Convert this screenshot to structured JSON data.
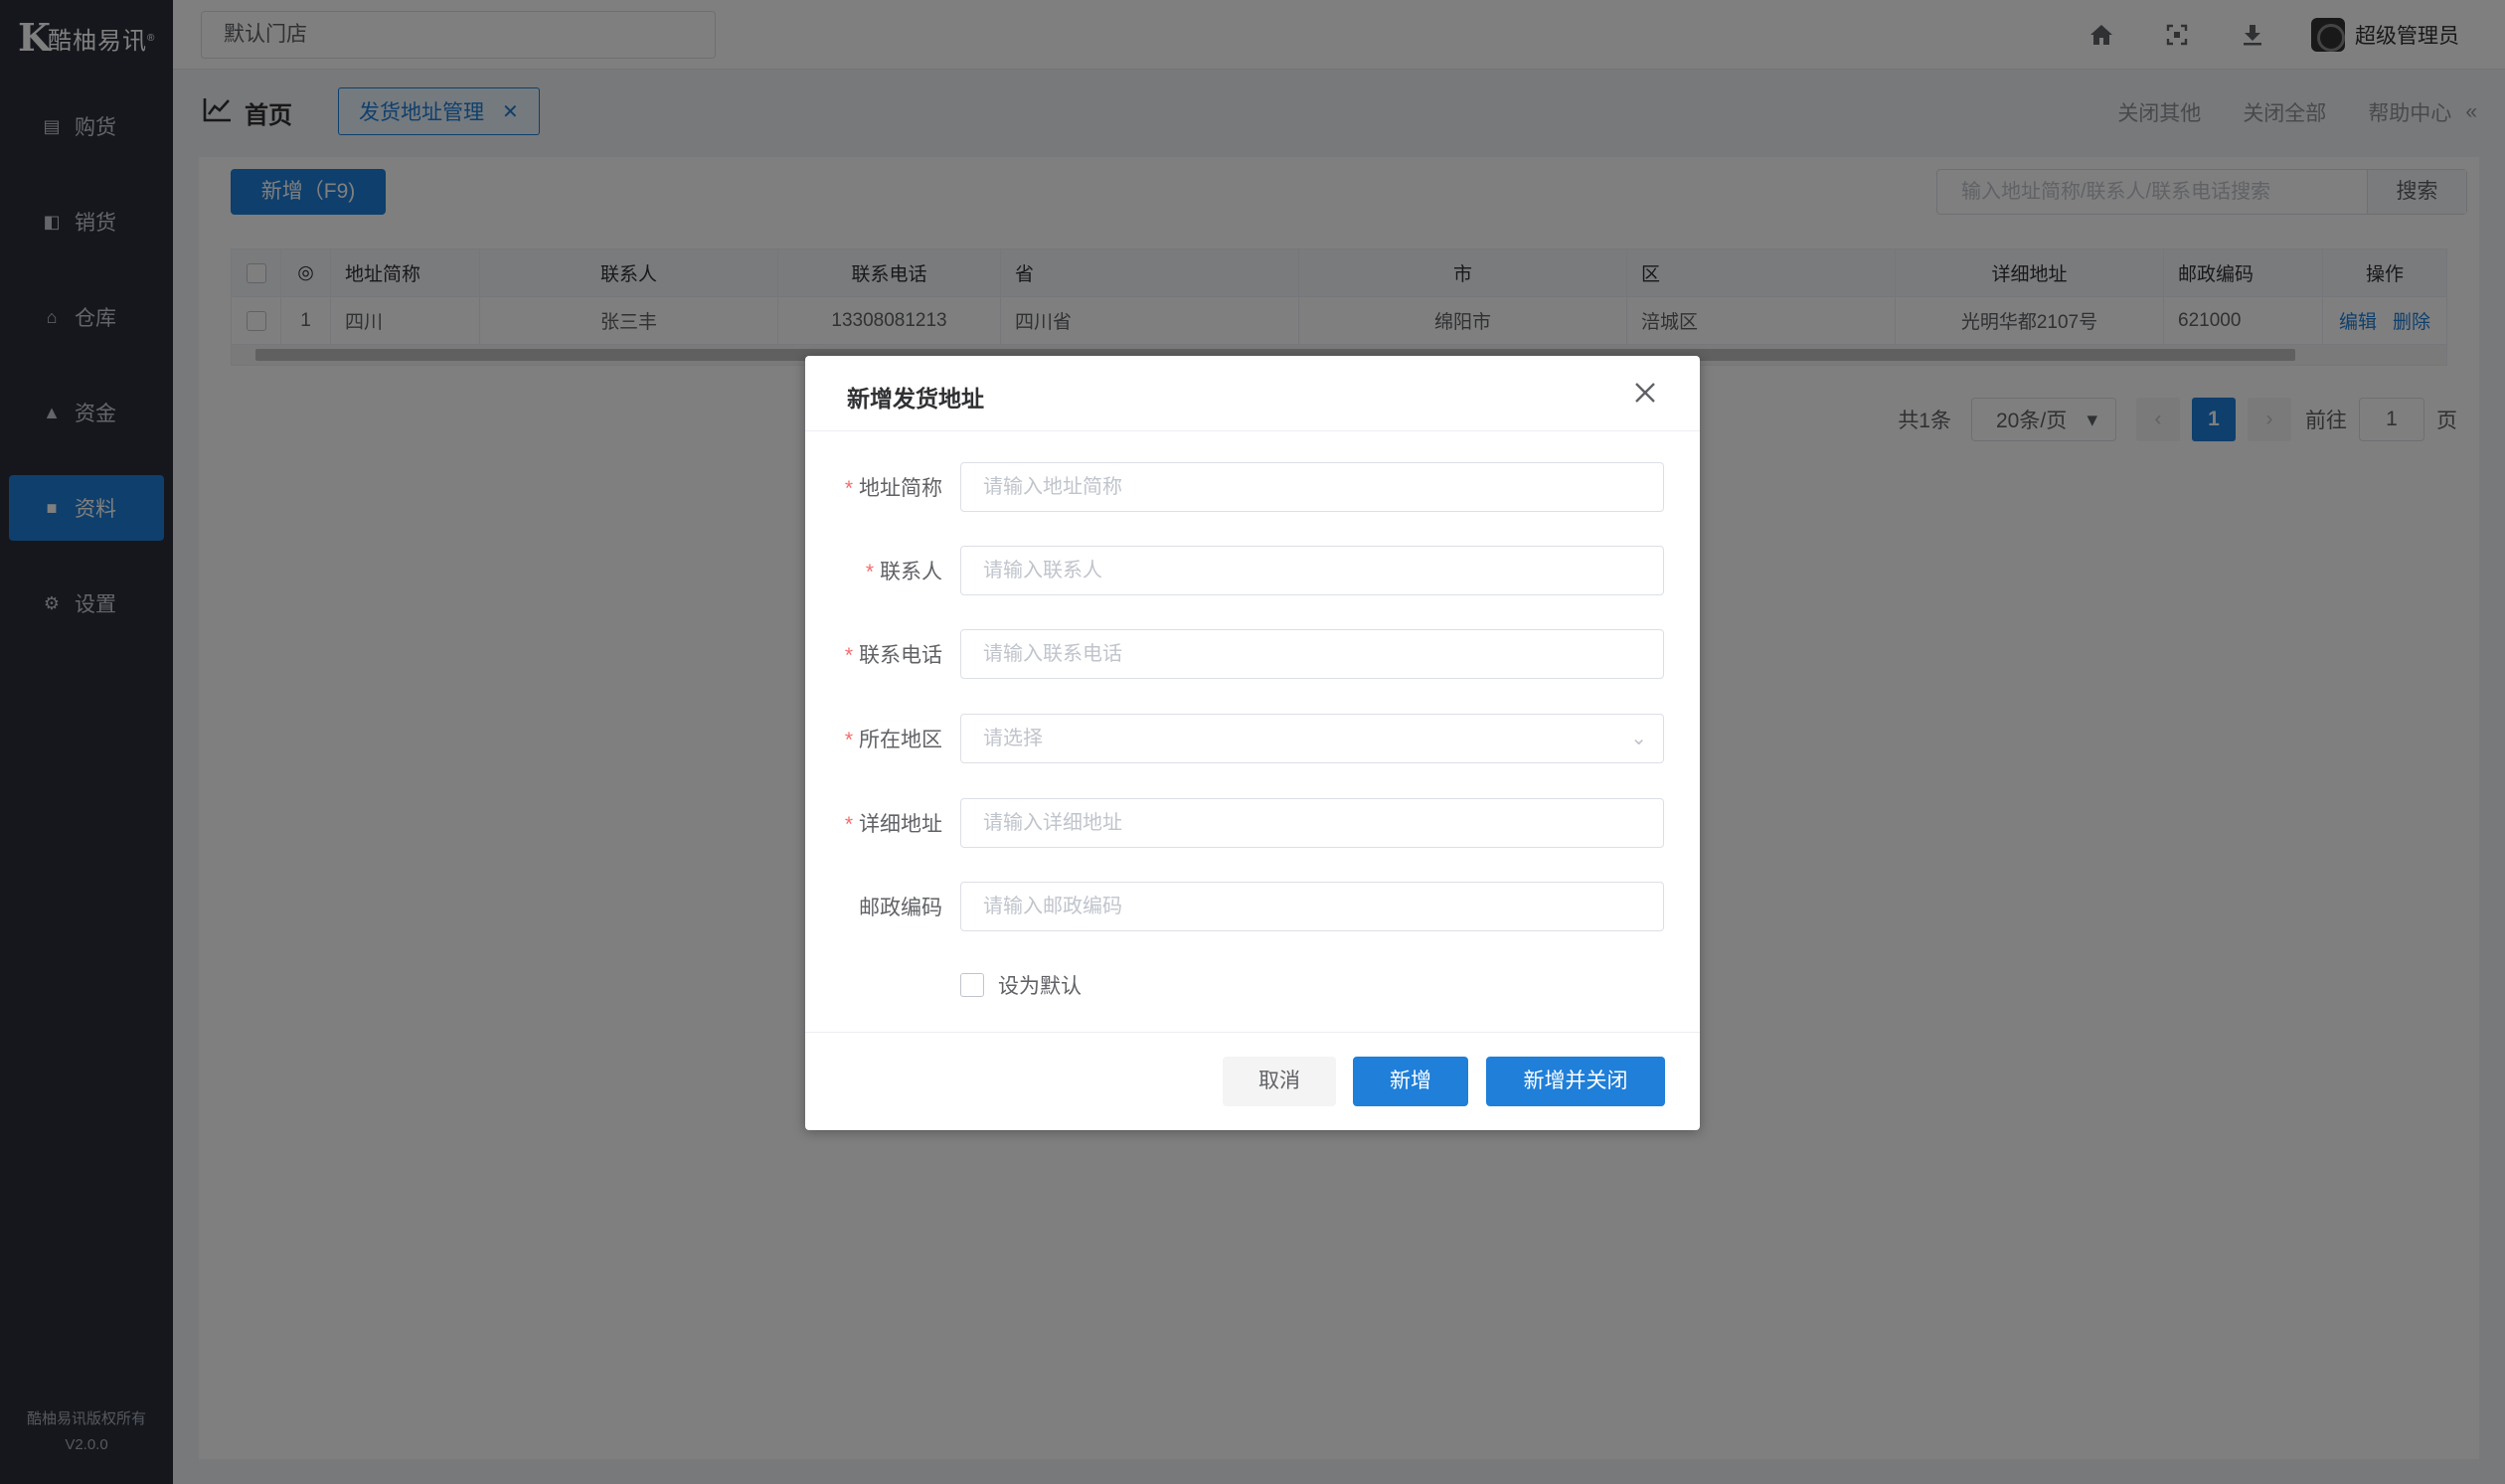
{
  "app": {
    "brand": "酷柚易讯",
    "copyright": "酷柚易讯版权所有",
    "version": "V2.0.0"
  },
  "sidebar": {
    "items": [
      {
        "label": "购货",
        "icon": "cart-icon",
        "active": false
      },
      {
        "label": "销货",
        "icon": "bag-icon",
        "active": false
      },
      {
        "label": "仓库",
        "icon": "warehouse-icon",
        "active": false
      },
      {
        "label": "资金",
        "icon": "money-icon",
        "active": false
      },
      {
        "label": "资料",
        "icon": "truck-icon",
        "active": true
      },
      {
        "label": "设置",
        "icon": "gear-icon",
        "active": false
      }
    ]
  },
  "header": {
    "store": "默认门店",
    "username": "超级管理员"
  },
  "tabs": {
    "home_label": "首页",
    "active_tab": "发货地址管理",
    "close_others": "关闭其他",
    "close_all": "关闭全部",
    "help": "帮助中心"
  },
  "toolbar": {
    "add_label": "新增（F9)",
    "search_placeholder": "输入地址简称/联系人/联系电话搜索",
    "search_button": "搜索"
  },
  "table": {
    "columns": [
      "地址简称",
      "联系人",
      "联系电话",
      "省",
      "市",
      "区",
      "详细地址",
      "邮政编码",
      "操作"
    ],
    "rows": [
      {
        "index": "1",
        "name": "四川",
        "contact": "张三丰",
        "phone": "13308081213",
        "province": "四川省",
        "city": "绵阳市",
        "district": "涪城区",
        "address": "光明华都2107号",
        "zip": "621000",
        "edit": "编辑",
        "delete": "删除"
      }
    ]
  },
  "pagination": {
    "total": "共1条",
    "page_size": "20条/页",
    "current": "1",
    "goto_prefix": "前往",
    "goto_value": "1",
    "goto_suffix": "页"
  },
  "modal": {
    "title": "新增发货地址",
    "fields": {
      "name": {
        "label": "地址简称",
        "placeholder": "请输入地址简称",
        "required": true
      },
      "contact": {
        "label": "联系人",
        "placeholder": "请输入联系人",
        "required": true
      },
      "phone": {
        "label": "联系电话",
        "placeholder": "请输入联系电话",
        "required": true
      },
      "region": {
        "label": "所在地区",
        "placeholder": "请选择",
        "required": true
      },
      "address": {
        "label": "详细地址",
        "placeholder": "请输入详细地址",
        "required": true
      },
      "zip": {
        "label": "邮政编码",
        "placeholder": "请输入邮政编码",
        "required": false
      }
    },
    "default_checkbox": "设为默认",
    "cancel": "取消",
    "add": "新增",
    "add_close": "新增并关闭"
  },
  "colors": {
    "primary": "#1f7fd9",
    "sidebar_bg": "#2a2e3a",
    "required": "#f56c6c"
  }
}
